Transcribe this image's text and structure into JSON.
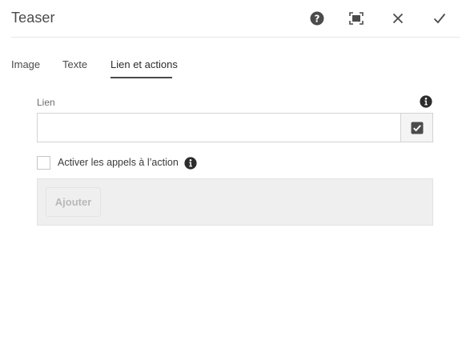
{
  "dialog": {
    "title": "Teaser"
  },
  "header_actions": [
    {
      "icon": "help-icon"
    },
    {
      "icon": "fullscreen-icon"
    },
    {
      "icon": "close-icon"
    },
    {
      "icon": "checkmark-icon"
    }
  ],
  "tabs": [
    {
      "label": "Image",
      "active": false
    },
    {
      "label": "Texte",
      "active": false
    },
    {
      "label": "Lien et actions",
      "active": true
    }
  ],
  "link_field": {
    "label": "Lien",
    "value": "",
    "info_icon": "info-icon",
    "picker_icon": "checkbox-picker-icon"
  },
  "actions": {
    "checkbox_label": "Activer les appels à l’action",
    "checked": false,
    "info_icon": "info-icon",
    "add_button_label": "Ajouter",
    "add_button_disabled": true
  },
  "colors": {
    "text": "#2c2c2c",
    "muted_text": "#6e6e6e",
    "disabled_text": "#b9b9b9",
    "border": "#d3d3d3",
    "panel_bg": "#efefef",
    "icon": "#2c2c2c"
  }
}
